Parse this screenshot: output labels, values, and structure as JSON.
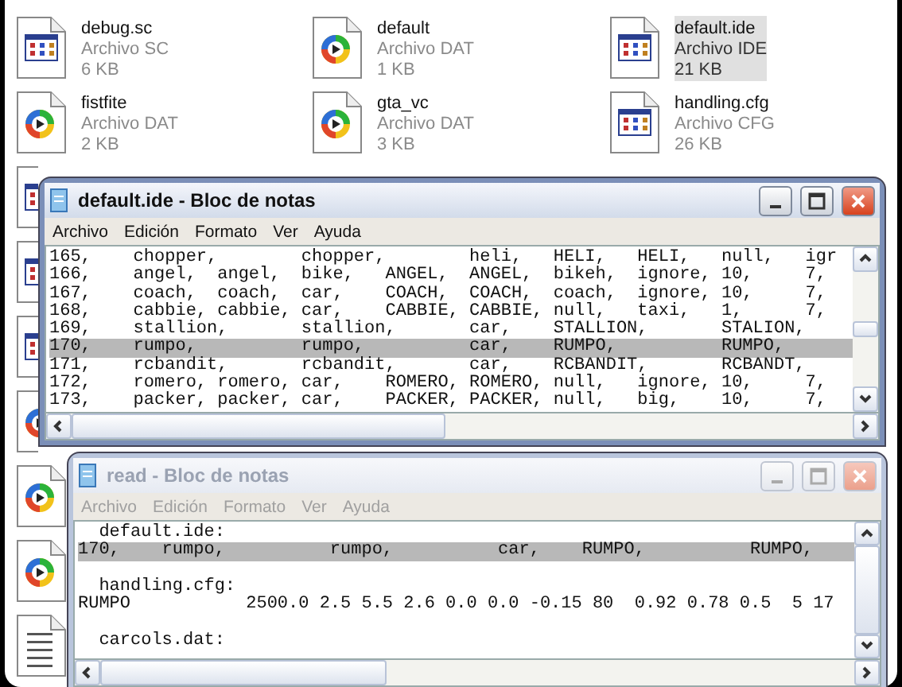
{
  "explorer": {
    "items": [
      {
        "name": "debug.sc",
        "type": "Archivo SC",
        "size": "6 KB",
        "kind": "app",
        "selected": false
      },
      {
        "name": "default",
        "type": "Archivo DAT",
        "size": "1 KB",
        "kind": "media",
        "selected": false
      },
      {
        "name": "default.ide",
        "type": "Archivo IDE",
        "size": "21 KB",
        "kind": "app",
        "selected": true
      },
      {
        "name": "fistfite",
        "type": "Archivo DAT",
        "size": "2 KB",
        "kind": "media",
        "selected": false
      },
      {
        "name": "gta_vc",
        "type": "Archivo DAT",
        "size": "3 KB",
        "kind": "media",
        "selected": false
      },
      {
        "name": "handling.cfg",
        "type": "Archivo CFG",
        "size": "26 KB",
        "kind": "app",
        "selected": false
      }
    ],
    "side_icons": [
      {
        "kind": "app"
      },
      {
        "kind": "app"
      },
      {
        "kind": "app"
      },
      {
        "kind": "media"
      },
      {
        "kind": "media"
      },
      {
        "kind": "media"
      },
      {
        "kind": "notepad"
      }
    ]
  },
  "windows": [
    {
      "title": "default.ide - Bloc de notas",
      "active": true,
      "menu": [
        "Archivo",
        "Edición",
        "Formato",
        "Ver",
        "Ayuda"
      ],
      "lines": [
        {
          "kind": "text",
          "text": "165,    chopper,        chopper,        heli,   HELI,   HELI,   null,   igr",
          "selected": false
        },
        {
          "kind": "text",
          "text": "166,    angel,  angel,  bike,   ANGEL,  ANGEL,  bikeh,  ignore, 10,     7,",
          "selected": false
        },
        {
          "kind": "text",
          "text": "167,    coach,  coach,  car,    COACH,  COACH,  coach,  ignore, 10,     7,",
          "selected": false
        },
        {
          "kind": "text",
          "text": "168,    cabbie, cabbie, car,    CABBIE, CABBIE, null,   taxi,   1,      7,",
          "selected": false
        },
        {
          "kind": "text",
          "text": "169,    stallion,       stallion,       car,    STALLION,       STALION,",
          "selected": false
        },
        {
          "kind": "text",
          "text": "170,    rumpo,          rumpo,          car,    RUMPO,          RUMPO,",
          "selected": true
        },
        {
          "kind": "text",
          "text": "171,    rcbandit,       rcbandit,       car,    RCBANDIT,       RCBANDT,",
          "selected": false
        },
        {
          "kind": "text",
          "text": "172,    romero, romero, car,    ROMERO, ROMERO, null,   ignore, 10,     7,",
          "selected": false
        },
        {
          "kind": "text",
          "text": "173,    packer, packer, car,    PACKER, PACKER, null,   big,    10,     7,",
          "selected": false
        }
      ]
    },
    {
      "title": "read - Bloc de notas",
      "active": false,
      "menu": [
        "Archivo",
        "Edición",
        "Formato",
        "Ver",
        "Ayuda"
      ],
      "lines": [
        {
          "kind": "text",
          "text": "  default.ide:",
          "selected": false
        },
        {
          "kind": "text",
          "text": "170,    rumpo,          rumpo,          car,    RUMPO,          RUMPO,",
          "selected": true
        },
        {
          "kind": "blank"
        },
        {
          "kind": "text",
          "text": "  handling.cfg:",
          "selected": false
        },
        {
          "kind": "text",
          "text": "RUMPO           2500.0 2.5 5.5 2.6 0.0 0.0 -0.15 80  0.92 0.78 0.5  5 17",
          "selected": false
        },
        {
          "kind": "blank"
        },
        {
          "kind": "text",
          "text": "  carcols.dat:",
          "selected": false
        }
      ]
    }
  ]
}
